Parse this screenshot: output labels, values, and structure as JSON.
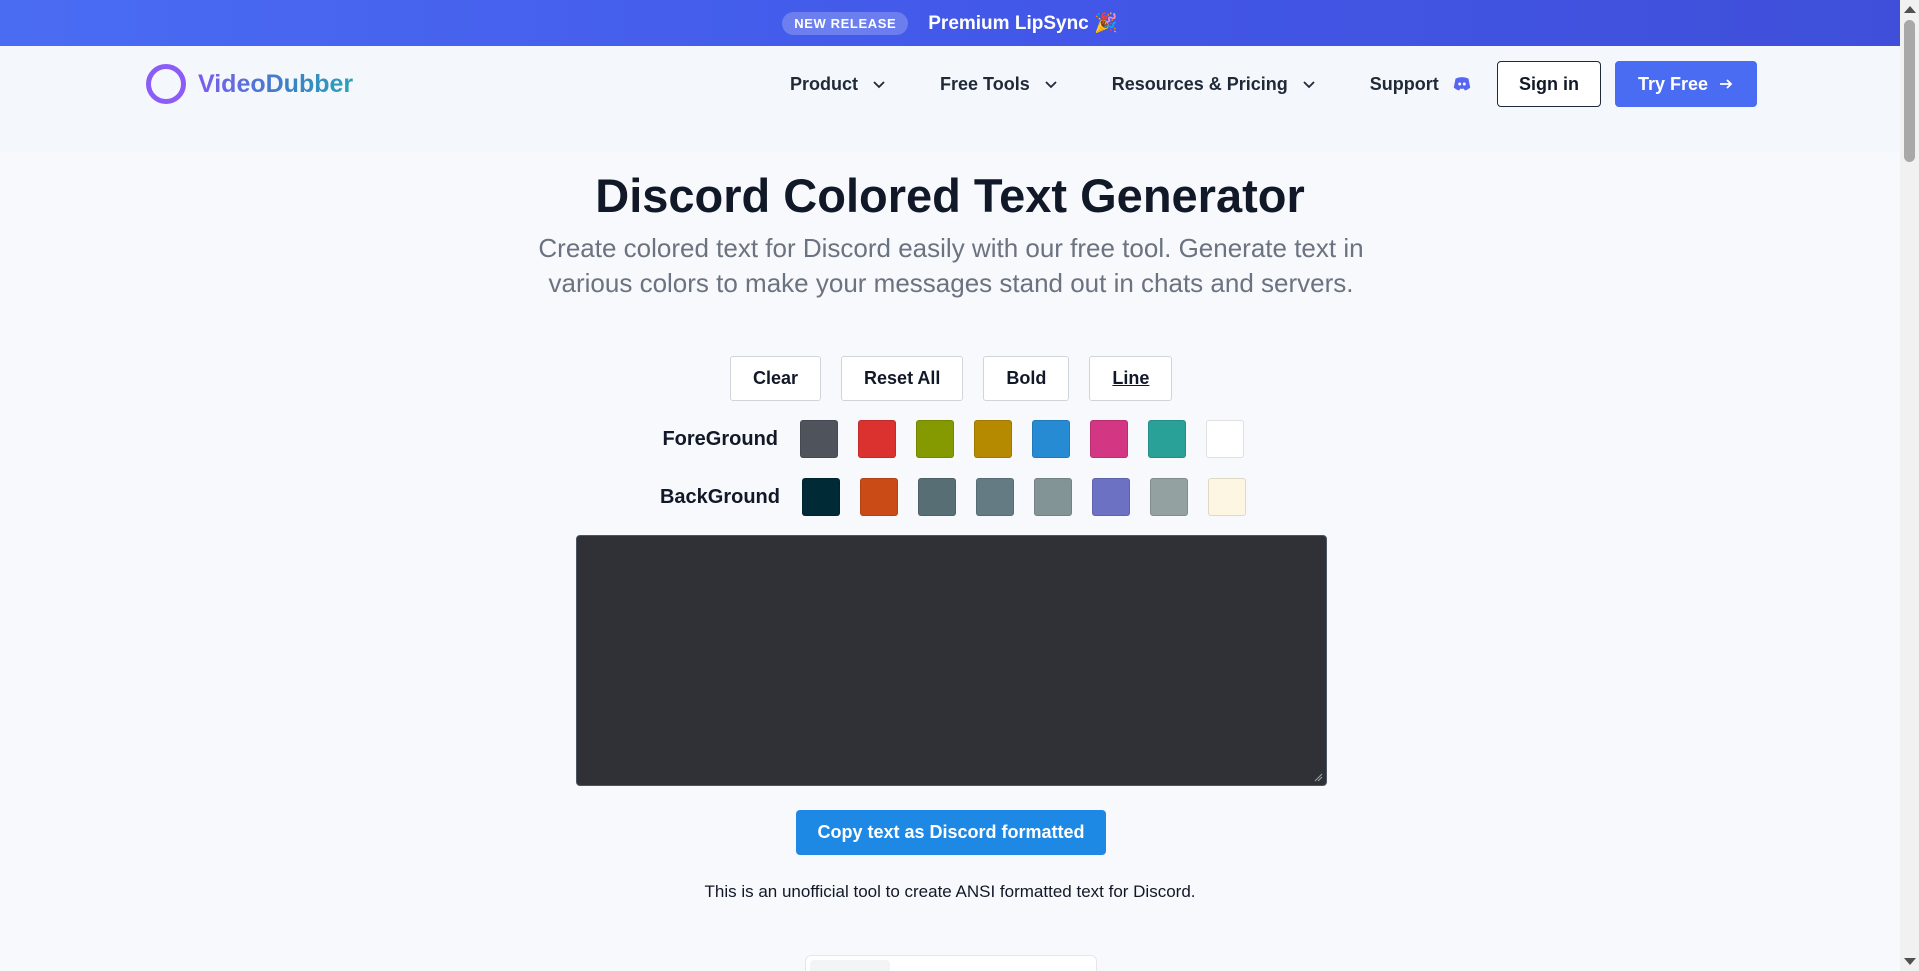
{
  "announcement": {
    "badge": "NEW RELEASE",
    "message": "Premium LipSync 🎉"
  },
  "header": {
    "logo_text": "VideoDubber",
    "nav": [
      {
        "label": "Product",
        "icon": "chevron-down-icon"
      },
      {
        "label": "Free Tools",
        "icon": "chevron-down-icon"
      },
      {
        "label": "Resources & Pricing",
        "icon": "chevron-down-icon"
      },
      {
        "label": "Support",
        "icon": "discord-icon"
      }
    ],
    "sign_in": "Sign in",
    "try_free": "Try Free"
  },
  "main": {
    "title": "Discord Colored Text Generator",
    "subtitle": "Create colored text for Discord easily with our free tool. Generate text in various colors to make your messages stand out in chats and servers.",
    "toolbar": {
      "clear": "Clear",
      "reset": "Reset All",
      "bold": "Bold",
      "line": "Line"
    },
    "foreground": {
      "label": "ForeGround",
      "colors": [
        "#4f545c",
        "#dc322f",
        "#859900",
        "#b58900",
        "#268bd2",
        "#d33682",
        "#2aa198",
        "#ffffff"
      ]
    },
    "background": {
      "label": "BackGround",
      "colors": [
        "#002b36",
        "#cb4b16",
        "#586e75",
        "#657b83",
        "#839496",
        "#6c71c4",
        "#93a1a1",
        "#fdf6e3"
      ]
    },
    "editor_value": "",
    "copy_button": "Copy text as Discord formatted",
    "note": "This is an unofficial tool to create ANSI formatted text for Discord."
  },
  "colors": {
    "accent": "#4a6cf3",
    "copy_button": "#1e88e5",
    "editor_bg": "#2f3136"
  }
}
